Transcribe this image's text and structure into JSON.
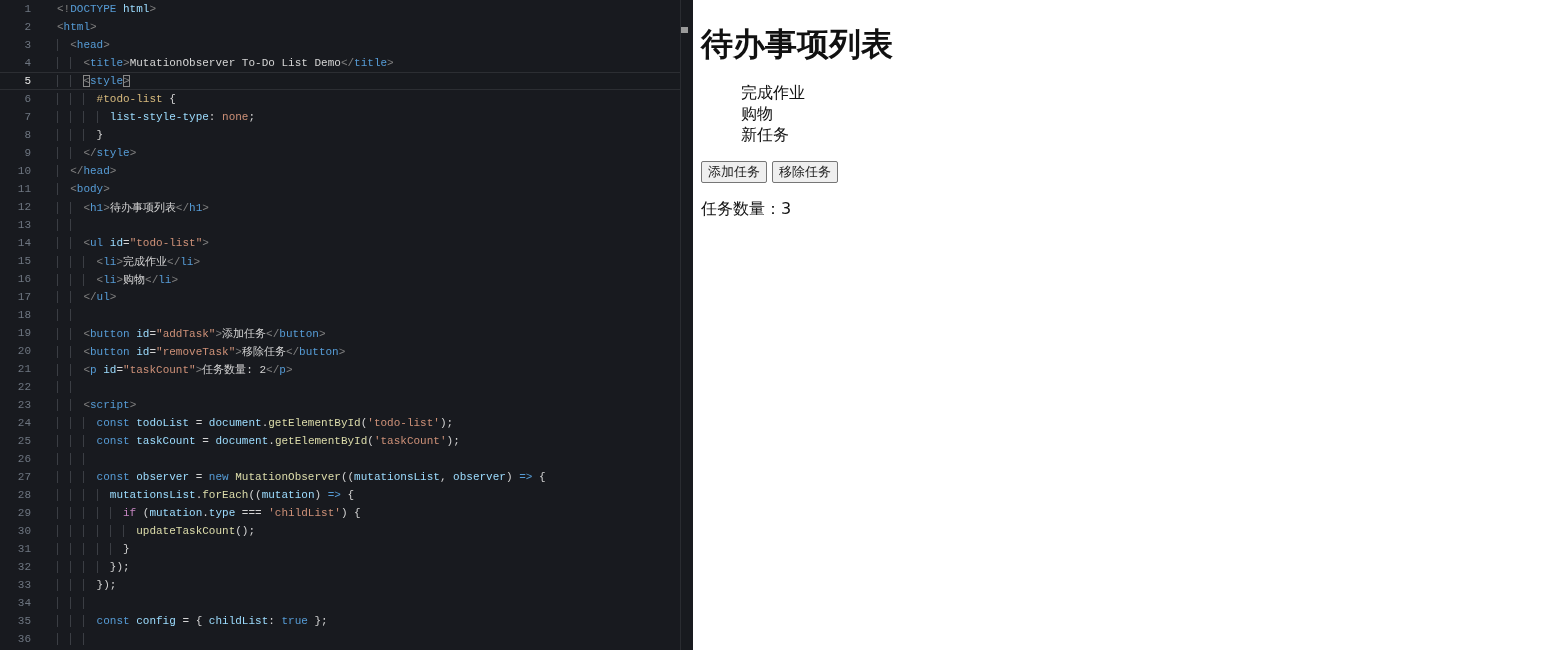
{
  "editor": {
    "lines": [
      {
        "number": "1",
        "current": false,
        "tokens": [
          {
            "kind": "punct",
            "text": "<!"
          },
          {
            "kind": "tag",
            "text": "DOCTYPE "
          },
          {
            "kind": "attr",
            "text": "html"
          },
          {
            "kind": "punct",
            "text": ">"
          }
        ]
      },
      {
        "number": "2",
        "current": false,
        "tokens": [
          {
            "kind": "punct",
            "text": "<"
          },
          {
            "kind": "tag",
            "text": "html"
          },
          {
            "kind": "punct",
            "text": ">"
          }
        ]
      },
      {
        "number": "3",
        "current": false,
        "tokens": [
          {
            "kind": "punct",
            "text": "  <"
          },
          {
            "kind": "tag",
            "text": "head"
          },
          {
            "kind": "punct",
            "text": ">"
          }
        ]
      },
      {
        "number": "4",
        "current": false,
        "tokens": [
          {
            "kind": "punct",
            "text": "    <"
          },
          {
            "kind": "tag",
            "text": "title"
          },
          {
            "kind": "punct",
            "text": ">"
          },
          {
            "kind": "plain",
            "text": "MutationObserver To-Do List Demo"
          },
          {
            "kind": "punct",
            "text": "</"
          },
          {
            "kind": "tag",
            "text": "title"
          },
          {
            "kind": "punct",
            "text": ">"
          }
        ]
      },
      {
        "number": "5",
        "current": true,
        "tokens": [
          {
            "kind": "match",
            "text": "    <"
          },
          {
            "kind": "tag",
            "text": "style"
          },
          {
            "kind": "match",
            "text": ">"
          }
        ]
      },
      {
        "number": "6",
        "current": false,
        "tokens": [
          {
            "kind": "selector",
            "text": "      #todo-list"
          },
          {
            "kind": "plain",
            "text": " {"
          }
        ]
      },
      {
        "number": "7",
        "current": false,
        "tokens": [
          {
            "kind": "attr",
            "text": "        list-style-type"
          },
          {
            "kind": "plain",
            "text": ": "
          },
          {
            "kind": "str",
            "text": "none"
          },
          {
            "kind": "plain",
            "text": ";"
          }
        ]
      },
      {
        "number": "8",
        "current": false,
        "tokens": [
          {
            "kind": "plain",
            "text": "      }"
          }
        ]
      },
      {
        "number": "9",
        "current": false,
        "tokens": [
          {
            "kind": "punct",
            "text": "    </"
          },
          {
            "kind": "tag",
            "text": "style"
          },
          {
            "kind": "punct",
            "text": ">"
          }
        ]
      },
      {
        "number": "10",
        "current": false,
        "tokens": [
          {
            "kind": "punct",
            "text": "  </"
          },
          {
            "kind": "tag",
            "text": "head"
          },
          {
            "kind": "punct",
            "text": ">"
          }
        ]
      },
      {
        "number": "11",
        "current": false,
        "tokens": [
          {
            "kind": "punct",
            "text": "  <"
          },
          {
            "kind": "tag",
            "text": "body"
          },
          {
            "kind": "punct",
            "text": ">"
          }
        ]
      },
      {
        "number": "12",
        "current": false,
        "tokens": [
          {
            "kind": "punct",
            "text": "    <"
          },
          {
            "kind": "tag",
            "text": "h1"
          },
          {
            "kind": "punct",
            "text": ">"
          },
          {
            "kind": "plain",
            "text": "待办事项列表"
          },
          {
            "kind": "punct",
            "text": "</"
          },
          {
            "kind": "tag",
            "text": "h1"
          },
          {
            "kind": "punct",
            "text": ">"
          }
        ]
      },
      {
        "number": "13",
        "current": false
      },
      {
        "number": "14",
        "current": false,
        "tokens": [
          {
            "kind": "punct",
            "text": "    <"
          },
          {
            "kind": "tag",
            "text": "ul "
          },
          {
            "kind": "attr",
            "text": "id"
          },
          {
            "kind": "plain",
            "text": "="
          },
          {
            "kind": "str",
            "text": "\"todo-list\""
          },
          {
            "kind": "punct",
            "text": ">"
          }
        ]
      },
      {
        "number": "15",
        "current": false,
        "tokens": [
          {
            "kind": "punct",
            "text": "      <"
          },
          {
            "kind": "tag",
            "text": "li"
          },
          {
            "kind": "punct",
            "text": ">"
          },
          {
            "kind": "plain",
            "text": "完成作业"
          },
          {
            "kind": "punct",
            "text": "</"
          },
          {
            "kind": "tag",
            "text": "li"
          },
          {
            "kind": "punct",
            "text": ">"
          }
        ]
      },
      {
        "number": "16",
        "current": false,
        "tokens": [
          {
            "kind": "punct",
            "text": "      <"
          },
          {
            "kind": "tag",
            "text": "li"
          },
          {
            "kind": "punct",
            "text": ">"
          },
          {
            "kind": "plain",
            "text": "购物"
          },
          {
            "kind": "punct",
            "text": "</"
          },
          {
            "kind": "tag",
            "text": "li"
          },
          {
            "kind": "punct",
            "text": ">"
          }
        ]
      },
      {
        "number": "17",
        "current": false,
        "tokens": [
          {
            "kind": "punct",
            "text": "    </"
          },
          {
            "kind": "tag",
            "text": "ul"
          },
          {
            "kind": "punct",
            "text": ">"
          }
        ]
      },
      {
        "number": "18",
        "current": false
      },
      {
        "number": "19",
        "current": false,
        "tokens": [
          {
            "kind": "punct",
            "text": "    <"
          },
          {
            "kind": "tag",
            "text": "button "
          },
          {
            "kind": "attr",
            "text": "id"
          },
          {
            "kind": "plain",
            "text": "="
          },
          {
            "kind": "str",
            "text": "\"addTask\""
          },
          {
            "kind": "punct",
            "text": ">"
          },
          {
            "kind": "plain",
            "text": "添加任务"
          },
          {
            "kind": "punct",
            "text": "</"
          },
          {
            "kind": "tag",
            "text": "button"
          },
          {
            "kind": "punct",
            "text": ">"
          }
        ]
      },
      {
        "number": "20",
        "current": false,
        "tokens": [
          {
            "kind": "punct",
            "text": "    <"
          },
          {
            "kind": "tag",
            "text": "button "
          },
          {
            "kind": "attr",
            "text": "id"
          },
          {
            "kind": "plain",
            "text": "="
          },
          {
            "kind": "str",
            "text": "\"removeTask\""
          },
          {
            "kind": "punct",
            "text": ">"
          },
          {
            "kind": "plain",
            "text": "移除任务"
          },
          {
            "kind": "punct",
            "text": "</"
          },
          {
            "kind": "tag",
            "text": "button"
          },
          {
            "kind": "punct",
            "text": ">"
          }
        ]
      },
      {
        "number": "21",
        "current": false,
        "tokens": [
          {
            "kind": "punct",
            "text": "    <"
          },
          {
            "kind": "tag",
            "text": "p "
          },
          {
            "kind": "attr",
            "text": "id"
          },
          {
            "kind": "plain",
            "text": "="
          },
          {
            "kind": "str",
            "text": "\"taskCount\""
          },
          {
            "kind": "punct",
            "text": ">"
          },
          {
            "kind": "plain",
            "text": "任务数量: 2"
          },
          {
            "kind": "punct",
            "text": "</"
          },
          {
            "kind": "tag",
            "text": "p"
          },
          {
            "kind": "punct",
            "text": ">"
          }
        ]
      },
      {
        "number": "22",
        "current": false
      },
      {
        "number": "23",
        "current": false,
        "tokens": [
          {
            "kind": "punct",
            "text": "    <"
          },
          {
            "kind": "tag",
            "text": "script"
          },
          {
            "kind": "punct",
            "text": ">"
          }
        ]
      },
      {
        "number": "24",
        "current": false,
        "tokens": [
          {
            "kind": "kw",
            "text": "      const "
          },
          {
            "kind": "attr",
            "text": "todoList"
          },
          {
            "kind": "plain",
            "text": " = "
          },
          {
            "kind": "attr",
            "text": "document"
          },
          {
            "kind": "plain",
            "text": "."
          },
          {
            "kind": "fn",
            "text": "getElementById"
          },
          {
            "kind": "plain",
            "text": "("
          },
          {
            "kind": "str",
            "text": "'todo-list'"
          },
          {
            "kind": "plain",
            "text": ");"
          }
        ]
      },
      {
        "number": "25",
        "current": false,
        "tokens": [
          {
            "kind": "kw",
            "text": "      const "
          },
          {
            "kind": "attr",
            "text": "taskCount"
          },
          {
            "kind": "plain",
            "text": " = "
          },
          {
            "kind": "attr",
            "text": "document"
          },
          {
            "kind": "plain",
            "text": "."
          },
          {
            "kind": "fn",
            "text": "getElementById"
          },
          {
            "kind": "plain",
            "text": "("
          },
          {
            "kind": "str",
            "text": "'taskCount'"
          },
          {
            "kind": "plain",
            "text": ");"
          }
        ]
      },
      {
        "number": "26",
        "current": false
      },
      {
        "number": "27",
        "current": false,
        "tokens": [
          {
            "kind": "kw",
            "text": "      const "
          },
          {
            "kind": "attr",
            "text": "observer"
          },
          {
            "kind": "plain",
            "text": " = "
          },
          {
            "kind": "kw",
            "text": "new "
          },
          {
            "kind": "fn",
            "text": "MutationObserver"
          },
          {
            "kind": "plain",
            "text": "(("
          },
          {
            "kind": "attr",
            "text": "mutationsList"
          },
          {
            "kind": "plain",
            "text": ", "
          },
          {
            "kind": "attr",
            "text": "observer"
          },
          {
            "kind": "plain",
            "text": ") "
          },
          {
            "kind": "kw",
            "text": "=>"
          },
          {
            "kind": "plain",
            "text": " {"
          }
        ]
      },
      {
        "number": "28",
        "current": false,
        "tokens": [
          {
            "kind": "attr",
            "text": "        mutationsList"
          },
          {
            "kind": "plain",
            "text": "."
          },
          {
            "kind": "fn",
            "text": "forEach"
          },
          {
            "kind": "plain",
            "text": "(("
          },
          {
            "kind": "attr",
            "text": "mutation"
          },
          {
            "kind": "plain",
            "text": ") "
          },
          {
            "kind": "kw",
            "text": "=>"
          },
          {
            "kind": "plain",
            "text": " {"
          }
        ]
      },
      {
        "number": "29",
        "current": false,
        "tokens": [
          {
            "kind": "ctrl",
            "text": "          if"
          },
          {
            "kind": "plain",
            "text": " ("
          },
          {
            "kind": "attr",
            "text": "mutation"
          },
          {
            "kind": "plain",
            "text": "."
          },
          {
            "kind": "attr",
            "text": "type"
          },
          {
            "kind": "plain",
            "text": " === "
          },
          {
            "kind": "str",
            "text": "'childList'"
          },
          {
            "kind": "plain",
            "text": ") {"
          }
        ]
      },
      {
        "number": "30",
        "current": false,
        "tokens": [
          {
            "kind": "fn",
            "text": "            updateTaskCount"
          },
          {
            "kind": "plain",
            "text": "();"
          }
        ]
      },
      {
        "number": "31",
        "current": false,
        "tokens": [
          {
            "kind": "plain",
            "text": "          }"
          }
        ]
      },
      {
        "number": "32",
        "current": false,
        "tokens": [
          {
            "kind": "plain",
            "text": "        });"
          }
        ]
      },
      {
        "number": "33",
        "current": false,
        "tokens": [
          {
            "kind": "plain",
            "text": "      });"
          }
        ]
      },
      {
        "number": "34",
        "current": false
      },
      {
        "number": "35",
        "current": false,
        "tokens": [
          {
            "kind": "kw",
            "text": "      const "
          },
          {
            "kind": "attr",
            "text": "config"
          },
          {
            "kind": "plain",
            "text": " = { "
          },
          {
            "kind": "attr",
            "text": "childList"
          },
          {
            "kind": "plain",
            "text": ": "
          },
          {
            "kind": "kw",
            "text": "true"
          },
          {
            "kind": "plain",
            "text": " };"
          }
        ]
      },
      {
        "number": "36",
        "current": false
      }
    ]
  },
  "preview": {
    "heading": "待办事项列表",
    "items": [
      "完成作业",
      "购物",
      "新任务"
    ],
    "buttons": [
      "添加任务",
      "移除任务"
    ],
    "count": "任务数量：3"
  }
}
